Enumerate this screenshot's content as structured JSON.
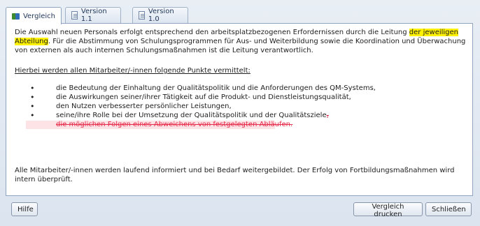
{
  "tabs": [
    {
      "label": "Vergleich",
      "icon": "compare-icon",
      "active": true
    },
    {
      "label": "Version 1.1",
      "icon": "document-icon",
      "active": false
    },
    {
      "label": "Version 1.0",
      "icon": "document-icon",
      "active": false
    }
  ],
  "content": {
    "intro_before": "Die Auswahl neuen Personals erfolgt entsprechend den arbeitsplatzbezogenen Erfordernissen durch die Leitung ",
    "intro_highlight": "der jeweiligen Abteilung",
    "intro_after": ". Für die Abstimmung von Schulungsprogrammen für Aus- und Weiterbildung sowie die Koordination und Überwachung von externen als auch internen Schulungsmaßnahmen ist die Leitung verantwortlich.",
    "heading": "Hierbei werden allen Mitarbeiter/-innen folgende Punkte vermittelt:",
    "points": [
      "die Bedeutung der Einhaltung der Qualitätspolitik und die Anforderungen des QM-Systems,",
      "die Auswirkungen seiner/ihrer Tätigkeit auf die Produkt- und Dienstleistungsqualität,",
      "den Nutzen verbesserter persönlicher Leistungen,",
      "seine/ihre Rolle bei der Umsetzung der Qualitätspolitik und der Qualitätsziele"
    ],
    "point4_deleted_suffix": ",",
    "deleted_point": "die möglichen Folgen eines Abweichens von festgelegten Abläufen.",
    "closing": "Alle Mitarbeiter/-innen werden laufend informiert und bei Bedarf weitergebildet. Der Erfolg von Fortbildungsmaßnahmen wird intern überprüft."
  },
  "buttons": {
    "help": "Hilfe",
    "print_comparison": "Vergleich drucken",
    "close": "Schließen"
  },
  "colors": {
    "highlight": "#fff200",
    "deleted_text": "#e62a49",
    "deleted_background": "#fde2e6"
  }
}
